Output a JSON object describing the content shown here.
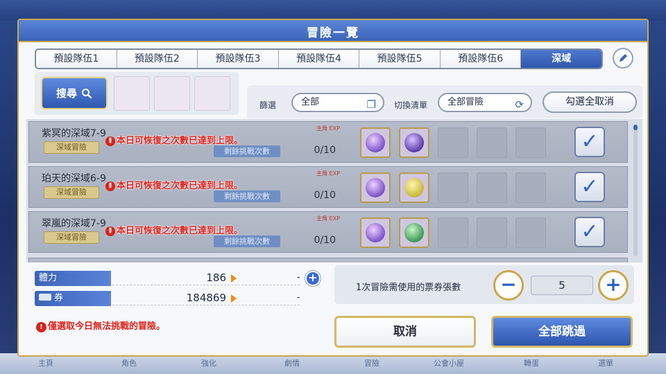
{
  "dialog": {
    "title": "冒險一覽"
  },
  "tabs": [
    {
      "label": "預設隊伍1",
      "active": false
    },
    {
      "label": "預設隊伍2",
      "active": false
    },
    {
      "label": "預設隊伍3",
      "active": false
    },
    {
      "label": "預設隊伍4",
      "active": false
    },
    {
      "label": "預設隊伍5",
      "active": false
    },
    {
      "label": "預設隊伍6",
      "active": false
    },
    {
      "label": "深域",
      "active": true
    }
  ],
  "search": {
    "label": "搜尋"
  },
  "filter": {
    "filter_label": "篩選",
    "filter_value": "全部",
    "switch_label": "切換清單",
    "switch_value": "全部冒險",
    "uncheck_all": "勾選全取消"
  },
  "quests": [
    {
      "title": "紫冥的深域7-9",
      "tag": "深域冒險",
      "limit_msg": "本日可恢復之次數已達到上限。",
      "remain_label": "剩餘挑戰次數",
      "exp_label": "主角 EXP",
      "count": "0/10",
      "checked": true,
      "reward_color": "#7a52c8"
    },
    {
      "title": "珀天的深域6-9",
      "tag": "深域冒險",
      "limit_msg": "本日可恢復之次數已達到上限。",
      "remain_label": "剩餘挑戰次數",
      "exp_label": "主角 EXP",
      "count": "0/10",
      "checked": true,
      "reward_color": "#d4c84a"
    },
    {
      "title": "翠嵐的深域7-9",
      "tag": "深域冒險",
      "limit_msg": "本日可恢復之次數已達到上限。",
      "remain_label": "剩餘挑戰次數",
      "exp_label": "主角 EXP",
      "count": "0/10",
      "checked": true,
      "reward_color": "#3fa85a"
    }
  ],
  "stats": {
    "stamina_label": "體力",
    "stamina_value": "186",
    "ticket_label": "券",
    "ticket_value": "184869",
    "dash": "-"
  },
  "notice": "僅選取今日無法挑戰的冒險。",
  "ticket_usage": {
    "label": "1次冒險需使用的票券張數",
    "quantity": "5",
    "minus": "−",
    "plus": "+"
  },
  "buttons": {
    "cancel": "取消",
    "skip_all": "全部跳過"
  },
  "bottom_nav": [
    "主頁",
    "角色",
    "強化",
    "劇情",
    "冒險",
    "公會小屋",
    "轉蛋",
    "選單"
  ]
}
